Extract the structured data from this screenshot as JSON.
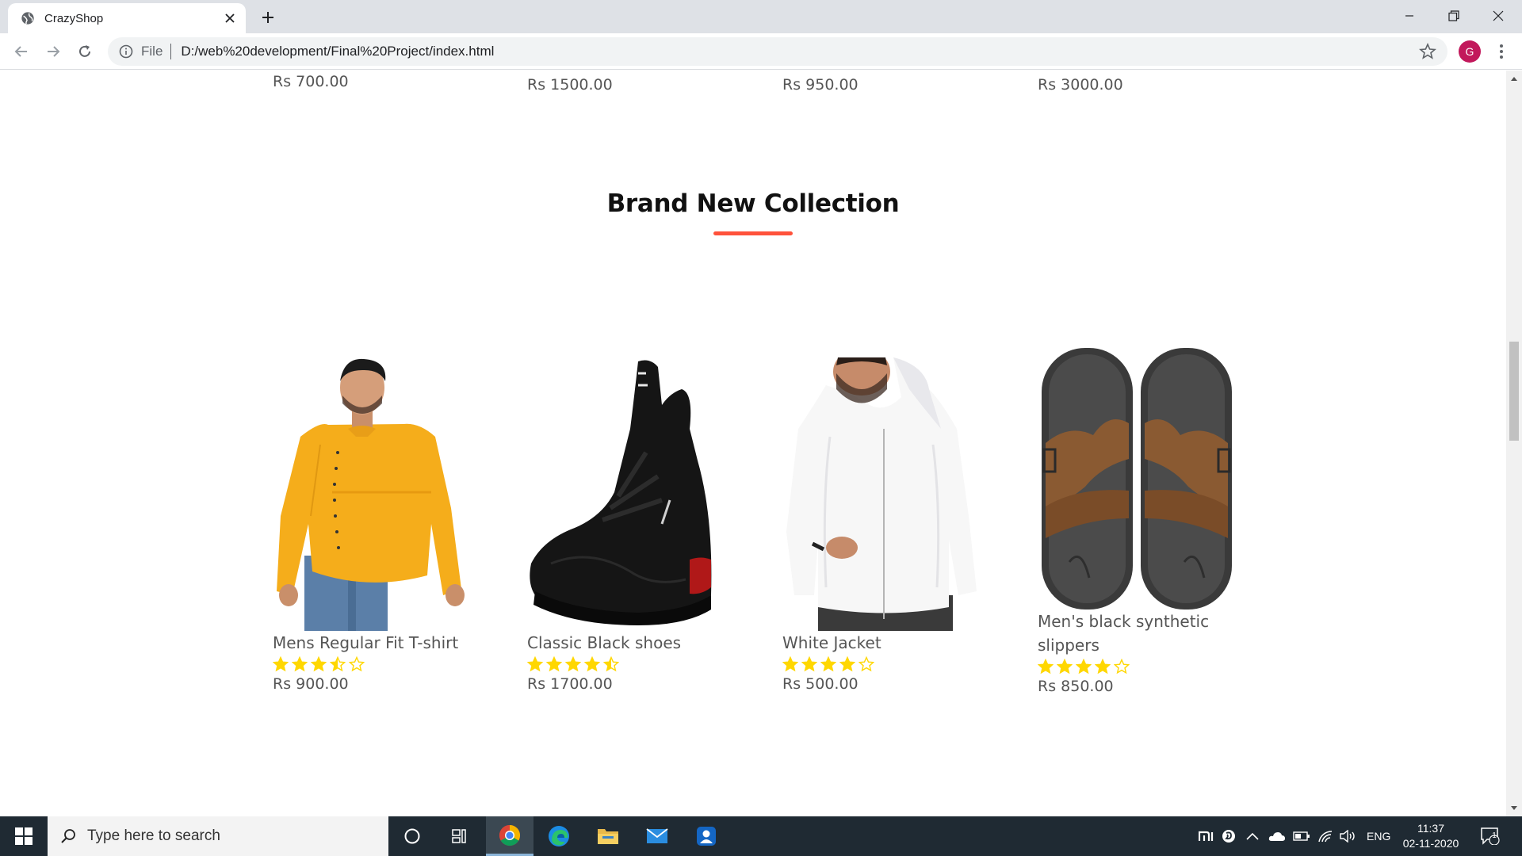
{
  "browser": {
    "tab_title": "CrazyShop",
    "url_scheme": "File",
    "url": "D:/web%20development/Final%20Project/index.html",
    "profile_initial": "G"
  },
  "page": {
    "prev_prices": [
      "Rs 700.00",
      "Rs 1500.00",
      "Rs 950.00",
      "Rs 3000.00"
    ],
    "section_title": "Brand New Collection",
    "accent_color": "#ff523b",
    "star_color": "#ffd700",
    "products": [
      {
        "name": "Mens Regular Fit T-shirt",
        "rating": 3.5,
        "price": "Rs 900.00",
        "image": "yellow-shirt-model"
      },
      {
        "name": "Classic Black shoes",
        "rating": 4.5,
        "price": "Rs 1700.00",
        "image": "black-sneaker"
      },
      {
        "name": "White Jacket",
        "rating": 4,
        "price": "Rs 500.00",
        "image": "white-hoodie-model"
      },
      {
        "name": "Men's black synthetic slippers",
        "rating": 4,
        "price": "Rs 850.00",
        "image": "brown-slippers"
      }
    ]
  },
  "taskbar": {
    "search_placeholder": "Type here to search",
    "language": "ENG",
    "time": "11:37",
    "date": "02-11-2020",
    "notification_count": "1"
  }
}
